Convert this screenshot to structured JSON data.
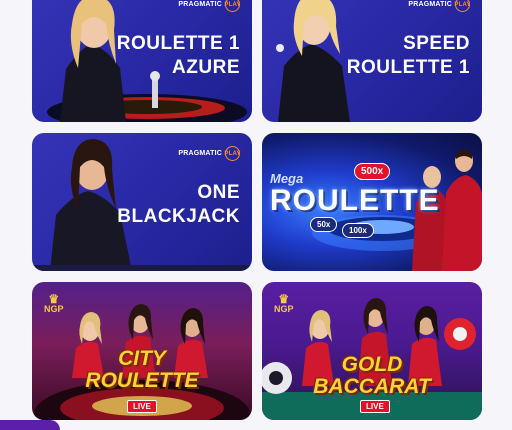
{
  "games": [
    {
      "title_lines": [
        "ROULETTE 1",
        "AZURE"
      ],
      "provider": "PRAGMATIC",
      "provider_mark": "PLAY"
    },
    {
      "title_lines": [
        "SPEED",
        "ROULETTE 1"
      ],
      "provider": "PRAGMATIC",
      "provider_mark": "PLAY"
    },
    {
      "title_lines": [
        "ONE",
        "BLACKJACK"
      ],
      "provider": "PRAGMATIC",
      "provider_mark": "PLAY"
    },
    {
      "logo_top": "Mega",
      "logo_main": "ROULETTE",
      "badges": [
        "500x",
        "50x",
        "100x"
      ]
    },
    {
      "provider": "NGP",
      "title_lines": [
        "CITY",
        "ROULETTE"
      ],
      "live": "LIVE"
    },
    {
      "provider": "NGP",
      "title_lines": [
        "GOLD",
        "BACCARAT"
      ],
      "live": "LIVE"
    }
  ],
  "colors": {
    "accent_orange": "#ff8a2a",
    "live_red": "#e3122b",
    "gold": "#ffd23a",
    "page_bg": "#f6f5fa"
  },
  "icons": [
    "pragmatic-play-logo-icon",
    "ngp-logo-icon"
  ]
}
